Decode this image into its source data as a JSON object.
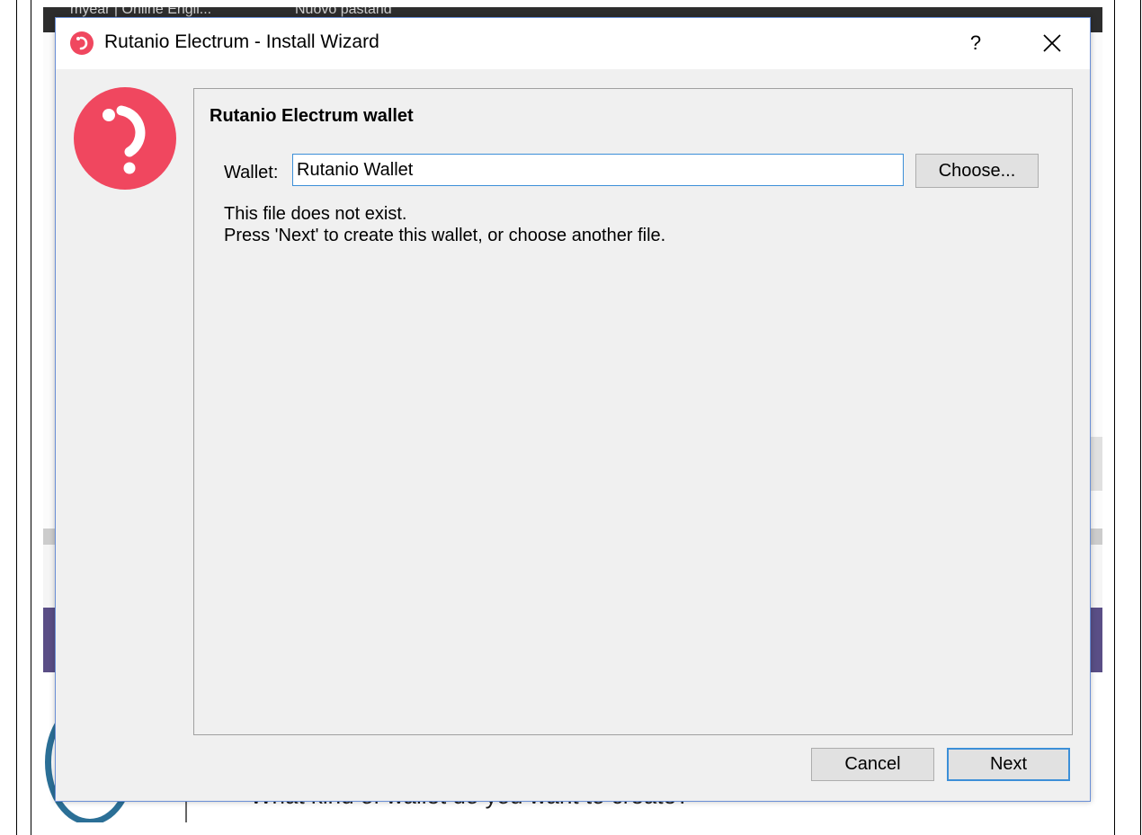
{
  "background": {
    "topbar_text_1": "myear | Online Engli...",
    "topbar_text_2": "Nuovo pastand",
    "bottom_text": "What kind of wallet do you want to create?"
  },
  "dialog": {
    "title": "Rutanio Electrum  -  Install Wizard",
    "help_label": "?",
    "panel": {
      "heading": "Rutanio Electrum wallet",
      "wallet_label": "Wallet:",
      "wallet_value": "Rutanio Wallet",
      "choose_label": "Choose...",
      "message_line1": "This file does not exist.",
      "message_line2": "Press 'Next' to create this wallet, or choose another file."
    },
    "cancel_label": "Cancel",
    "next_label": "Next"
  },
  "colors": {
    "brand": "#f0475f",
    "focus": "#3c8fd8",
    "dialog_bg": "#f0f0f0"
  }
}
